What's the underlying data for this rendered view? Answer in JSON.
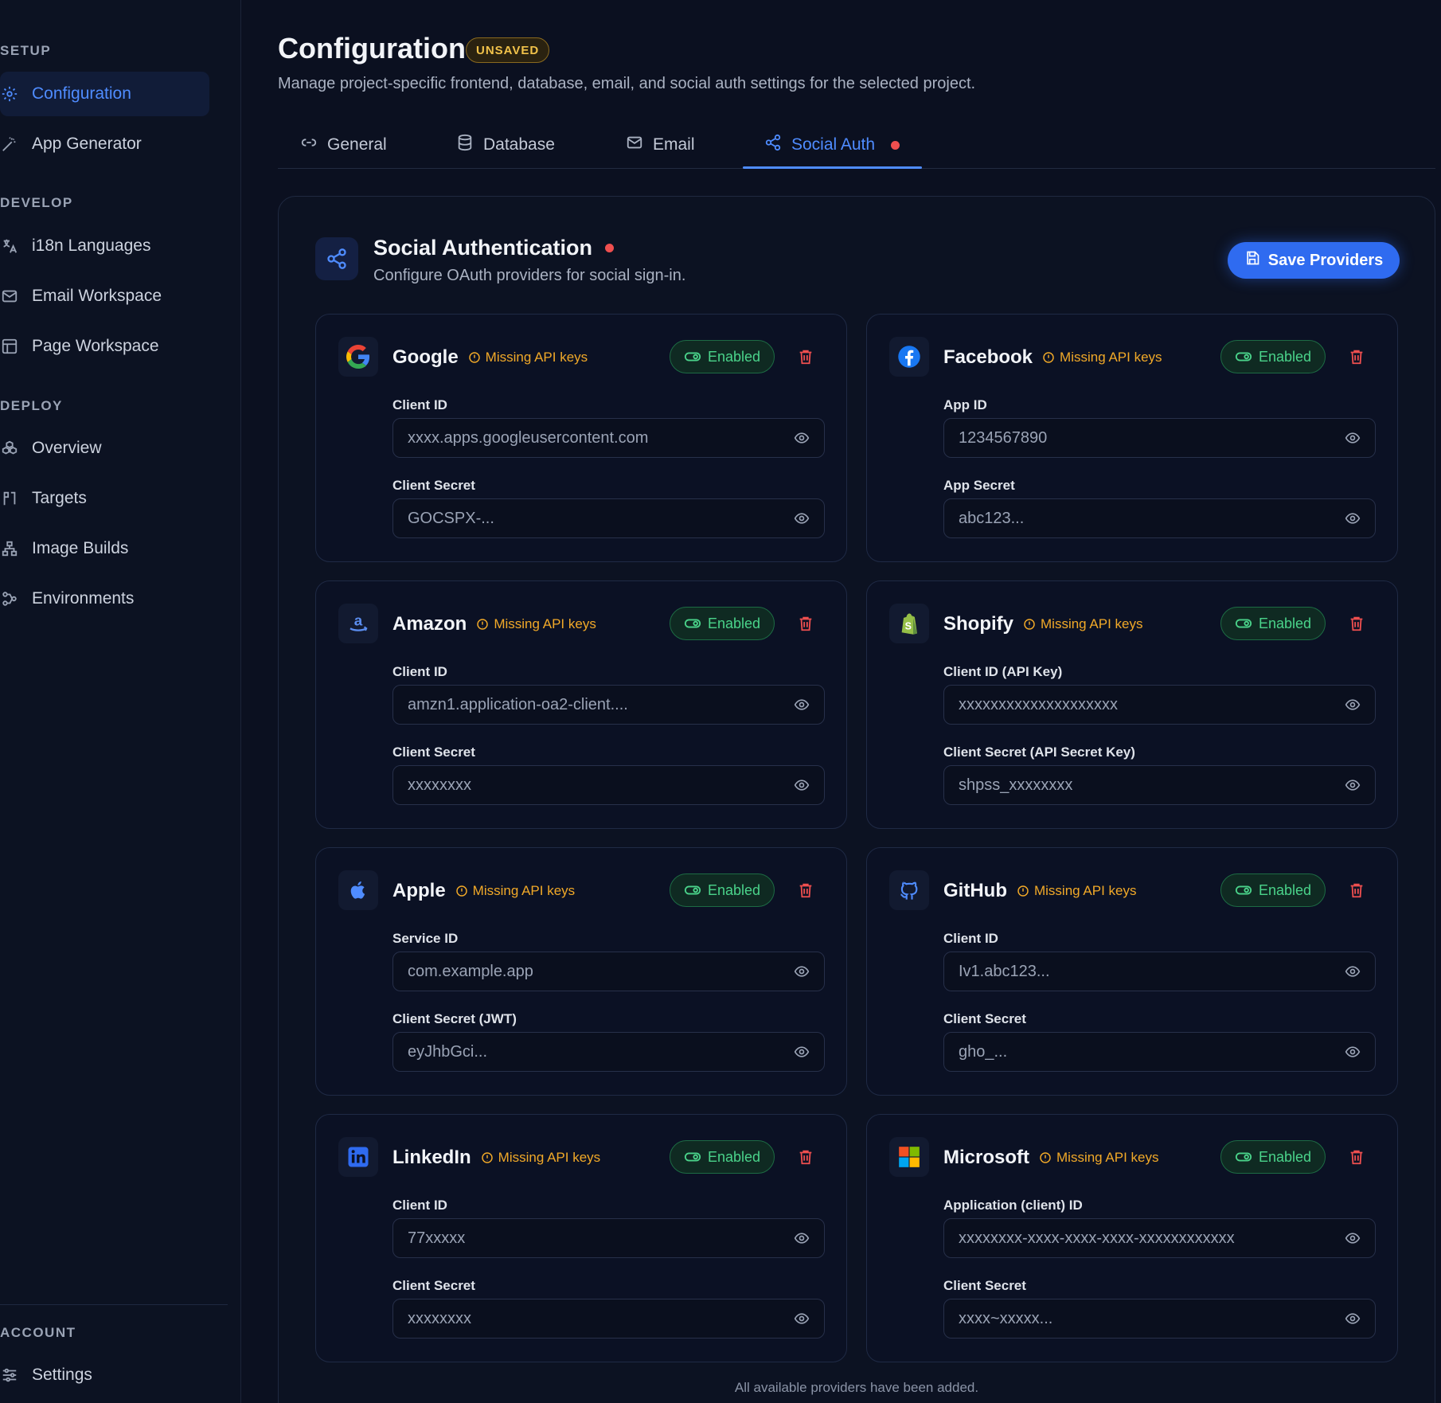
{
  "sidebar": {
    "sections": {
      "setup": "SETUP",
      "develop": "DEVELOP",
      "deploy": "DEPLOY",
      "account": "ACCOUNT"
    },
    "items": [
      {
        "label": "Configuration",
        "icon": "gear-icon",
        "active": true
      },
      {
        "label": "App Generator",
        "icon": "wand-icon"
      },
      {
        "label": "i18n Languages",
        "icon": "translate-icon"
      },
      {
        "label": "Email Workspace",
        "icon": "mail-icon"
      },
      {
        "label": "Page Workspace",
        "icon": "layout-icon"
      },
      {
        "label": "Overview",
        "icon": "boxes-icon"
      },
      {
        "label": "Targets",
        "icon": "target-icon"
      },
      {
        "label": "Image Builds",
        "icon": "network-icon"
      },
      {
        "label": "Environments",
        "icon": "workflow-icon"
      },
      {
        "label": "Settings",
        "icon": "sliders-icon"
      }
    ]
  },
  "header": {
    "title": "Configuration",
    "badge": "UNSAVED",
    "subtitle": "Manage project-specific frontend, database, email, and social auth settings for the selected project."
  },
  "tabs": [
    {
      "label": "General",
      "icon": "link-icon"
    },
    {
      "label": "Database",
      "icon": "database-icon"
    },
    {
      "label": "Email",
      "icon": "mail-icon"
    },
    {
      "label": "Social Auth",
      "icon": "share-icon",
      "active": true
    }
  ],
  "panel": {
    "title": "Social Authentication",
    "subtitle": "Configure OAuth providers for social sign-in.",
    "save_label": "Save Providers",
    "footer": "All available providers have been added."
  },
  "providers": [
    {
      "name": "Google",
      "warning": "Missing API keys",
      "status": "Enabled",
      "f1_label": "Client ID",
      "f1_value": "xxxx.apps.googleusercontent.com",
      "f2_label": "Client Secret",
      "f2_value": "GOCSPX-..."
    },
    {
      "name": "Facebook",
      "warning": "Missing API keys",
      "status": "Enabled",
      "f1_label": "App ID",
      "f1_value": "1234567890",
      "f2_label": "App Secret",
      "f2_value": "abc123..."
    },
    {
      "name": "Amazon",
      "warning": "Missing API keys",
      "status": "Enabled",
      "f1_label": "Client ID",
      "f1_value": "amzn1.application-oa2-client....",
      "f2_label": "Client Secret",
      "f2_value": "xxxxxxxx"
    },
    {
      "name": "Shopify",
      "warning": "Missing API keys",
      "status": "Enabled",
      "f1_label": "Client ID (API Key)",
      "f1_value": "xxxxxxxxxxxxxxxxxxxx",
      "f2_label": "Client Secret (API Secret Key)",
      "f2_value": "shpss_xxxxxxxx"
    },
    {
      "name": "Apple",
      "warning": "Missing API keys",
      "status": "Enabled",
      "f1_label": "Service ID",
      "f1_value": "com.example.app",
      "f2_label": "Client Secret (JWT)",
      "f2_value": "eyJhbGci..."
    },
    {
      "name": "GitHub",
      "warning": "Missing API keys",
      "status": "Enabled",
      "f1_label": "Client ID",
      "f1_value": "Iv1.abc123...",
      "f2_label": "Client Secret",
      "f2_value": "gho_..."
    },
    {
      "name": "LinkedIn",
      "warning": "Missing API keys",
      "status": "Enabled",
      "f1_label": "Client ID",
      "f1_value": "77xxxxx",
      "f2_label": "Client Secret",
      "f2_value": "xxxxxxxx"
    },
    {
      "name": "Microsoft",
      "warning": "Missing API keys",
      "status": "Enabled",
      "f1_label": "Application (client) ID",
      "f1_value": "xxxxxxxx-xxxx-xxxx-xxxx-xxxxxxxxxxxx",
      "f2_label": "Client Secret",
      "f2_value": "xxxx~xxxxx..."
    }
  ],
  "colors": {
    "accent": "#4f8cff",
    "warning": "#f1a928",
    "success": "#4ad38a",
    "danger": "#ef4f4f"
  }
}
